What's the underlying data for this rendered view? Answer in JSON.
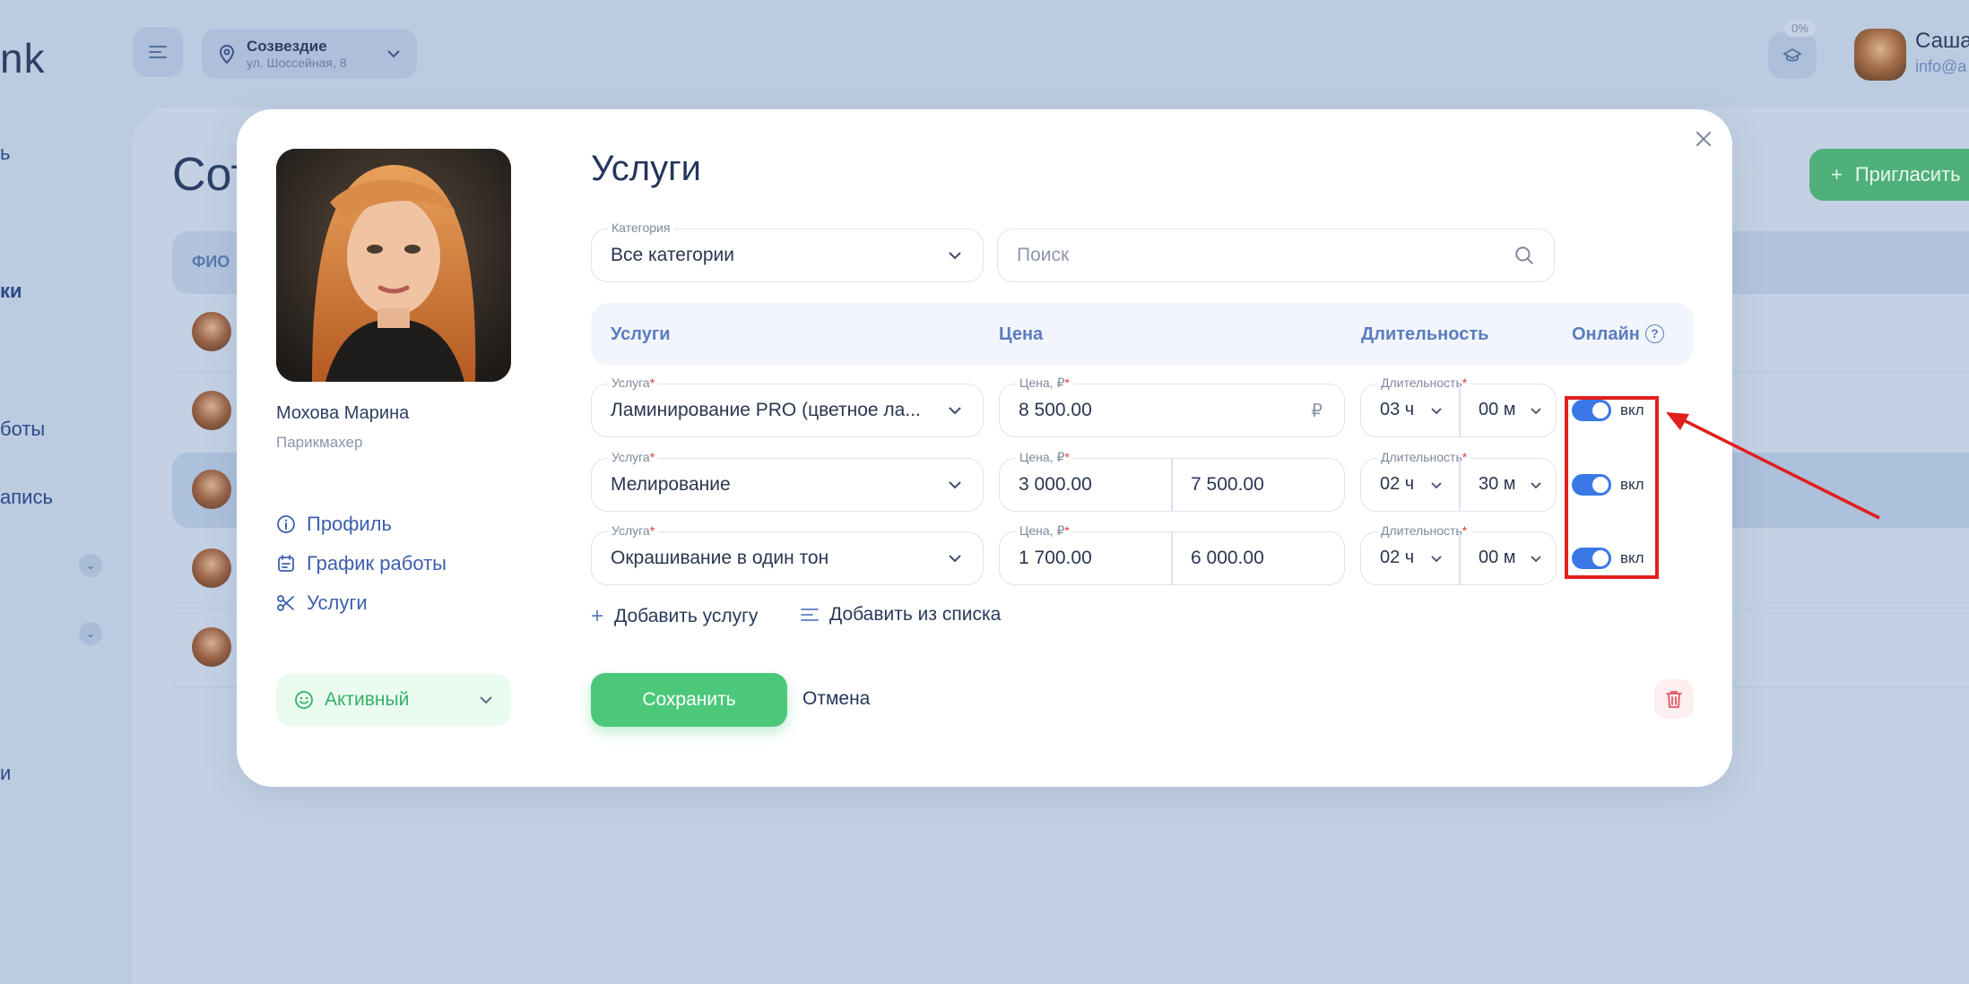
{
  "background": {
    "logo_fragment": "nk",
    "sidebar_fragments": [
      "ь",
      "ки",
      "боты",
      "апись",
      "и"
    ],
    "location": {
      "name": "Созвездие",
      "address": "ул. Шоссейная, 8"
    },
    "progress_badge": "0%",
    "user": {
      "name": "Саша",
      "email": "info@a"
    },
    "page_title_fragment": "Сот",
    "invite_button": "Пригласить",
    "table_header_fragment": "ФИО"
  },
  "profile": {
    "name": "Мохова Марина",
    "role": "Парикмахер",
    "nav": [
      {
        "label": "Профиль",
        "icon": "info-icon"
      },
      {
        "label": "График работы",
        "icon": "calendar-icon"
      },
      {
        "label": "Услуги",
        "icon": "scissors-icon"
      }
    ],
    "status": "Активный"
  },
  "modal": {
    "title": "Услуги",
    "category": {
      "label": "Категория",
      "value": "Все категории"
    },
    "search": {
      "placeholder": "Поиск"
    },
    "columns": {
      "service": "Услуги",
      "price": "Цена",
      "duration": "Длительность",
      "online": "Онлайн"
    },
    "field_labels": {
      "service": "Услуга",
      "price": "Цена, ₽",
      "duration": "Длительность",
      "required_mark": "*"
    },
    "currency_symbol": "₽",
    "services": [
      {
        "name": "Ламинирование PRO (цветное ла...",
        "price_from": "8 500.00",
        "price_to": "",
        "hours": "03 ч",
        "minutes": "00 м",
        "online": true,
        "online_label": "вкл"
      },
      {
        "name": "Мелирование",
        "price_from": "3 000.00",
        "price_to": "7 500.00",
        "hours": "02 ч",
        "minutes": "30 м",
        "online": true,
        "online_label": "вкл"
      },
      {
        "name": "Окрашивание в один тон",
        "price_from": "1 700.00",
        "price_to": "6 000.00",
        "hours": "02 ч",
        "minutes": "00 м",
        "online": true,
        "online_label": "вкл"
      }
    ],
    "add_service": "Добавить услугу",
    "add_from_list": "Добавить из списка",
    "save": "Сохранить",
    "cancel": "Отмена"
  },
  "colors": {
    "accent": "#3a78e8",
    "save": "#4cc87a",
    "status": "#34b165",
    "annotation": "#e01e1e"
  }
}
